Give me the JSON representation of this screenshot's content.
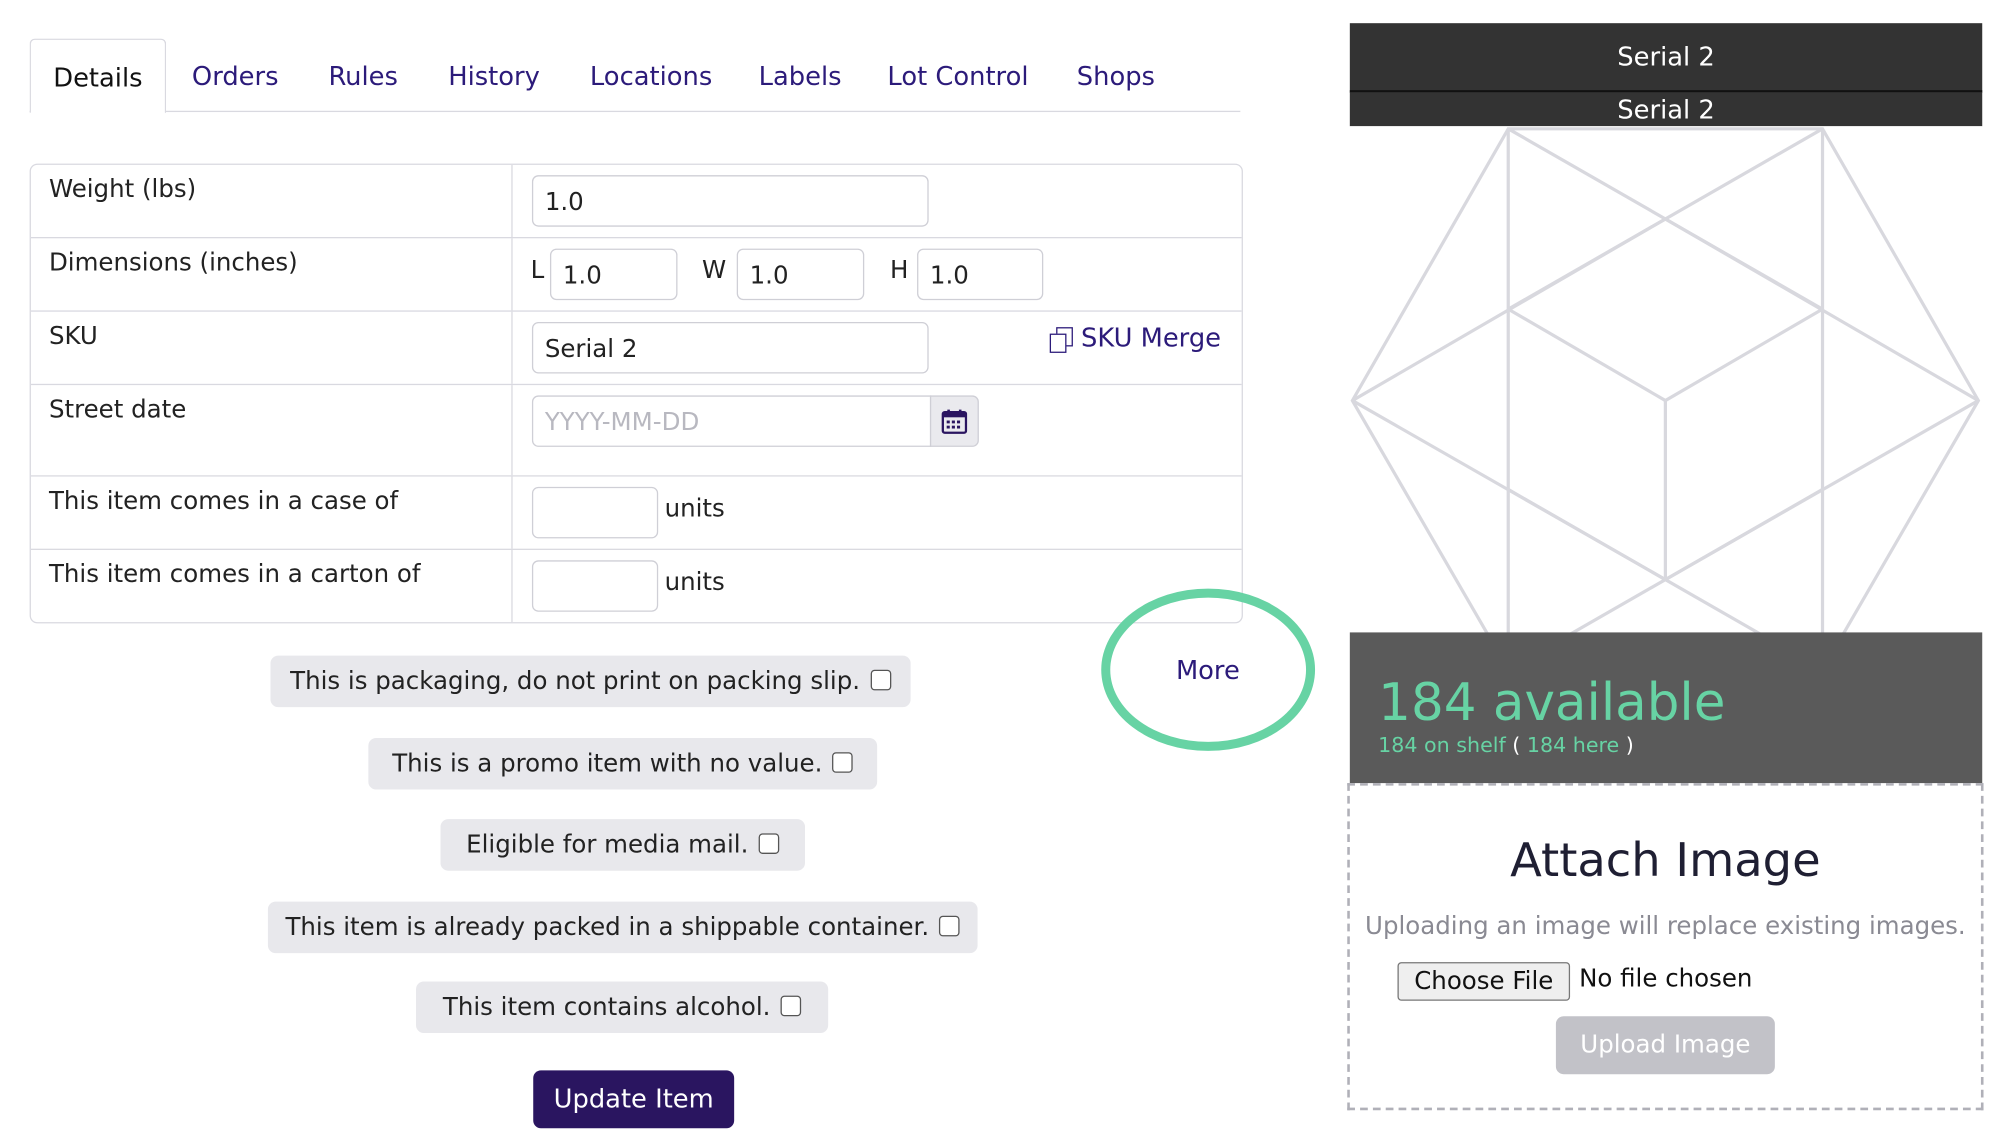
{
  "tabs": [
    {
      "label": "Details"
    },
    {
      "label": "Orders"
    },
    {
      "label": "Rules"
    },
    {
      "label": "History"
    },
    {
      "label": "Locations"
    },
    {
      "label": "Labels"
    },
    {
      "label": "Lot Control"
    },
    {
      "label": "Shops"
    }
  ],
  "form": {
    "weight": {
      "label": "Weight (lbs)",
      "value": "1.0"
    },
    "dimensions": {
      "label": "Dimensions (inches)",
      "l_label": "L",
      "l_value": "1.0",
      "w_label": "W",
      "w_value": "1.0",
      "h_label": "H",
      "h_value": "1.0"
    },
    "sku": {
      "label": "SKU",
      "value": "Serial 2",
      "merge_label": "SKU Merge"
    },
    "street_date": {
      "label": "Street date",
      "placeholder": "YYYY-MM-DD"
    },
    "case": {
      "label": "This item comes in a case of",
      "value": "",
      "units": "units"
    },
    "carton": {
      "label": "This item comes in a carton of",
      "value": "",
      "units": "units"
    }
  },
  "checkboxes": [
    {
      "label": "This is packaging, do not print on packing slip.",
      "checked": false
    },
    {
      "label": "This is a promo item with no value.",
      "checked": false
    },
    {
      "label": "Eligible for media mail.",
      "checked": false
    },
    {
      "label": "This item is already packed in a shippable container.",
      "checked": false
    },
    {
      "label": "This item contains alcohol.",
      "checked": false
    }
  ],
  "more_label": "More",
  "update_button": "Update Item",
  "right": {
    "title1": "Serial 2",
    "title2": "Serial 2",
    "available": "184 available",
    "on_shelf": "184 on shelf",
    "here": "184 here",
    "paren_open": "(",
    "paren_close": ")",
    "attach_title": "Attach Image",
    "attach_help": "Uploading an image will replace existing images.",
    "choose_file": "Choose File",
    "no_file": "No file chosen",
    "upload_button": "Upload Image"
  },
  "colors": {
    "accent": "#2a1560",
    "link": "#2c1b7a",
    "available": "#67d3a4",
    "highlight_ring": "#67d3a4"
  },
  "icons": {
    "sku_merge": "copy-icon",
    "street_date": "calendar-icon",
    "placeholder_image": "cube-icon"
  }
}
